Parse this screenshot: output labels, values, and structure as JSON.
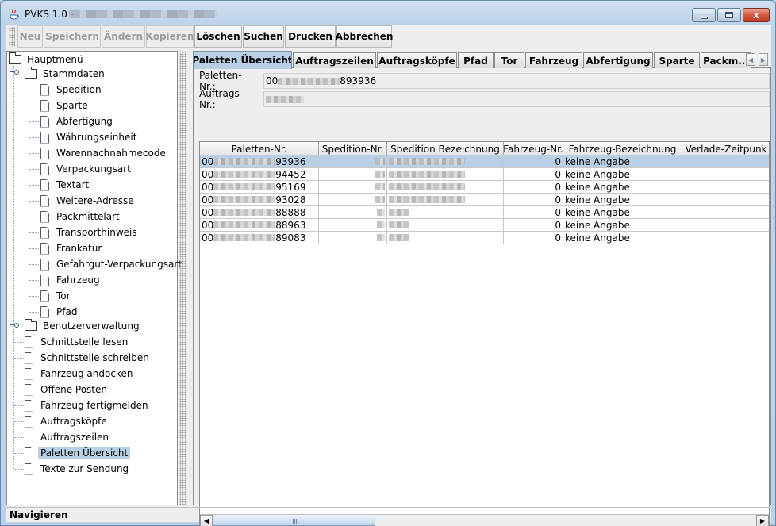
{
  "window": {
    "title": "PVKS 1.0 -",
    "min_glyph": "",
    "max_glyph": "",
    "close_glyph": "x"
  },
  "toolbar": {
    "buttons": [
      {
        "label": "Neu",
        "enabled": false
      },
      {
        "label": "Speichern",
        "enabled": false
      },
      {
        "label": "Ändern",
        "enabled": false
      },
      {
        "label": "Kopieren",
        "enabled": false
      },
      {
        "label": "Löschen",
        "enabled": true
      },
      {
        "label": "Suchen",
        "enabled": true
      },
      {
        "label": "Drucken",
        "enabled": true
      },
      {
        "label": "Abbrechen",
        "enabled": true
      }
    ]
  },
  "tree": {
    "root": "Hauptmenü",
    "stammdaten": {
      "label": "Stammdaten",
      "items": [
        "Spedition",
        "Sparte",
        "Abfertigung",
        "Währungseinheit",
        "Warennachnahmecode",
        "Verpackungsart",
        "Textart",
        "Weitere-Adresse",
        "Packmittelart",
        "Transporthinweis",
        "Frankatur",
        "Gefahrgut-Verpackungsart",
        "Fahrzeug",
        "Tor",
        "Pfad"
      ]
    },
    "benutzerverwaltung": {
      "label": "Benutzerverwaltung"
    },
    "items": [
      "Schnittstelle lesen",
      "Schnittstelle schreiben",
      "Fahrzeug andocken",
      "Offene Posten",
      "Fahrzeug fertigmelden",
      "Auftragsköpfe",
      "Auftragszeilen",
      "Paletten Übersicht",
      "Texte zur Sendung"
    ],
    "selected": "Paletten Übersicht"
  },
  "tabs": {
    "items": [
      "Paletten Übersicht",
      "Auftragszeilen",
      "Auftragsköpfe",
      "Pfad",
      "Tor",
      "Fahrzeug",
      "Abfertigung",
      "Sparte",
      "Packm..."
    ],
    "active": "Paletten Übersicht"
  },
  "form": {
    "paletten_label": "Paletten-Nr.:",
    "paletten_prefix": "00",
    "paletten_suffix": "893936",
    "auftrags_label": "Auftrags-Nr.:"
  },
  "table": {
    "columns": [
      "Paletten-Nr.",
      "Spedition-Nr.",
      "Spedition Bezeichnung",
      "Fahrzeug-Nr.",
      "Fahrzeug-Bezeichnung",
      "Verlade-Zeitpunk"
    ],
    "rows": [
      {
        "paletten_prefix": "00",
        "paletten_suffix": "93936",
        "fahrzeug_nr": "0",
        "fahrzeug_bez": "keine Angabe"
      },
      {
        "paletten_prefix": "00",
        "paletten_suffix": "94452",
        "fahrzeug_nr": "0",
        "fahrzeug_bez": "keine Angabe"
      },
      {
        "paletten_prefix": "00",
        "paletten_suffix": "95169",
        "fahrzeug_nr": "0",
        "fahrzeug_bez": "keine Angabe"
      },
      {
        "paletten_prefix": "00",
        "paletten_suffix": "93028",
        "fahrzeug_nr": "0",
        "fahrzeug_bez": "keine Angabe"
      },
      {
        "paletten_prefix": "00",
        "paletten_suffix": "88888",
        "fahrzeug_nr": "0",
        "fahrzeug_bez": "keine Angabe"
      },
      {
        "paletten_prefix": "00",
        "paletten_suffix": "88963",
        "fahrzeug_nr": "0",
        "fahrzeug_bez": "keine Angabe"
      },
      {
        "paletten_prefix": "00",
        "paletten_suffix": "89083",
        "fahrzeug_nr": "0",
        "fahrzeug_bez": "keine Angabe"
      }
    ],
    "selected_row": 0
  },
  "status": {
    "text": "Navigieren"
  },
  "colors": {
    "selection": "#b8cfe5",
    "title_gradient": "#b9d1ea",
    "close_button": "#d4593f"
  }
}
